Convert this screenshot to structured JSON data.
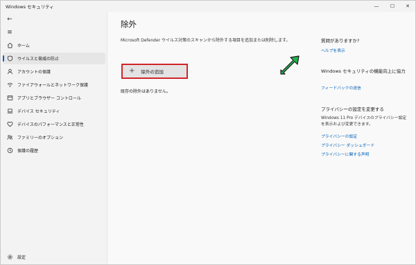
{
  "app": {
    "title": "Windows セキュリティ"
  },
  "window_controls": {
    "minimize": "—",
    "maximize": "☐",
    "close": "✕"
  },
  "sidebar": {
    "back_icon": "←",
    "menu_icon": "≡",
    "items": [
      {
        "label": "ホーム",
        "icon": "home-icon",
        "active": false
      },
      {
        "label": "ウイルスと脅威の防止",
        "icon": "shield-icon",
        "active": true
      },
      {
        "label": "アカウントの保護",
        "icon": "person-icon",
        "active": false
      },
      {
        "label": "ファイアウォールとネットワーク保護",
        "icon": "wifi-icon",
        "active": false
      },
      {
        "label": "アプリとブラウザー コントロール",
        "icon": "app-window-icon",
        "active": false
      },
      {
        "label": "デバイス セキュリティ",
        "icon": "laptop-icon",
        "active": false
      },
      {
        "label": "デバイスのパフォーマンスと正常性",
        "icon": "heart-icon",
        "active": false
      },
      {
        "label": "ファミリーのオプション",
        "icon": "family-icon",
        "active": false
      },
      {
        "label": "保護の履歴",
        "icon": "history-icon",
        "active": false
      }
    ],
    "settings_label": "設定"
  },
  "main": {
    "title": "除外",
    "description": "Microsoft Defender ウイルス対策のスキャンから除外する項目を追加または削除します。",
    "add_button_label": "除外の追加",
    "add_button_icon": "+",
    "empty_text": "既存の除外はありません。"
  },
  "right_panel": {
    "q_heading": "質問がありますか?",
    "help_link": "ヘルプを表示",
    "improve_heading": "Windows セキュリティの機能向上に協力",
    "feedback_link": "フィードバックの送信",
    "privacy_heading": "プライバシーの設定を変更する",
    "privacy_text": "Windows 11 Pro デバイスのプライバシー設定を表示および変更できます。",
    "privacy_links": [
      "プライバシーの設定",
      "プライバシー ダッシュボード",
      "プライバシーに関する声明"
    ]
  },
  "colors": {
    "accent": "#005fb8",
    "highlight_border": "#d1232a",
    "arrow": "#22b14c"
  }
}
